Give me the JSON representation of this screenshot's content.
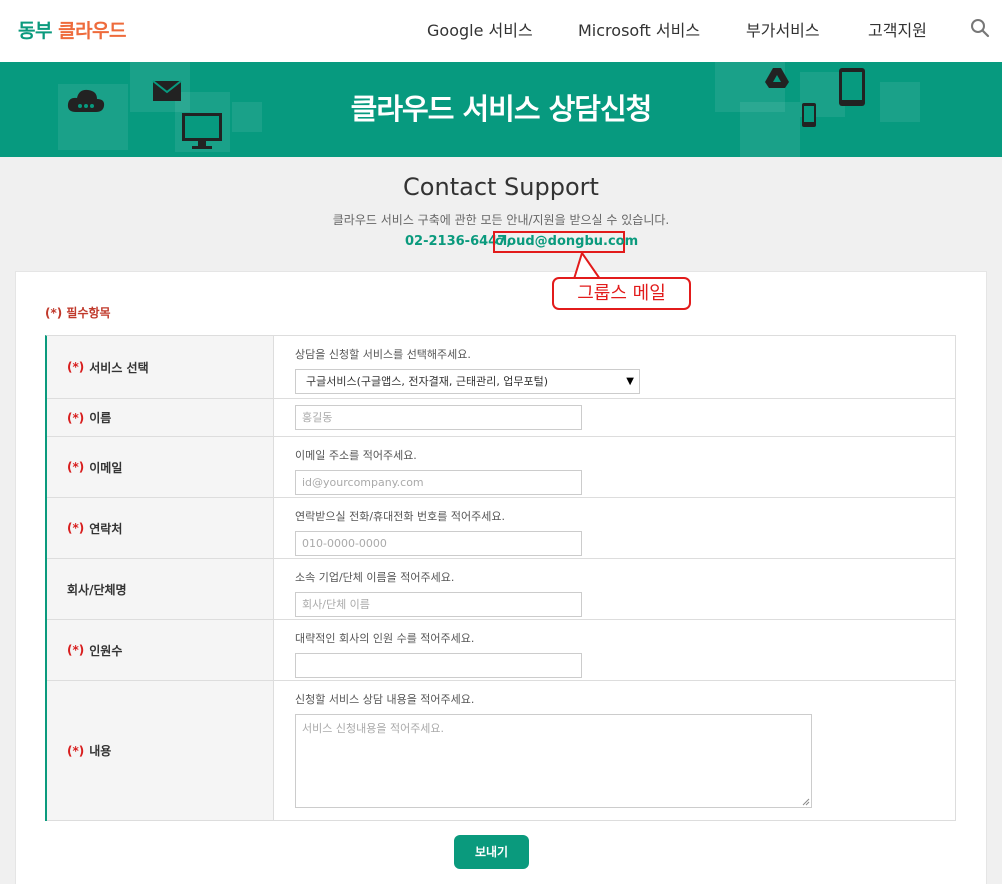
{
  "logo": {
    "part1": "동부",
    "part2": "클라우드"
  },
  "nav": {
    "items": [
      "Google 서비스",
      "Microsoft 서비스",
      "부가서비스",
      "고객지원"
    ],
    "search_icon": "search-icon"
  },
  "banner": {
    "title": "클라우드 서비스 상담신청"
  },
  "intro": {
    "title": "Contact Support",
    "description": "클라우드 서비스 구축에 관한 모든 안내/지원을 받으실 수 있습니다.",
    "phone": "02-2136-6447,",
    "email": "cloud@dongbu.com"
  },
  "annotation": {
    "label": "그룹스 메일"
  },
  "form": {
    "required_note": "(*) 필수항목",
    "required_mark": "(*)",
    "fields": {
      "service": {
        "label": "서비스 선택",
        "hint": "상담을 신청할 서비스를 선택해주세요.",
        "selected": "구글서비스(구글앱스, 전자결재, 근태관리, 업무포털)"
      },
      "name": {
        "label": "이름",
        "placeholder": "홍길동"
      },
      "email": {
        "label": "이메일",
        "hint": "이메일 주소를 적어주세요.",
        "placeholder": "id@yourcompany.com"
      },
      "phone": {
        "label": "연락처",
        "hint": "연락받으실 전화/휴대전화 번호를 적어주세요.",
        "placeholder": "010-0000-0000"
      },
      "company": {
        "label": "회사/단체명",
        "hint": "소속 기업/단체 이름을 적어주세요.",
        "placeholder": "회사/단체 이름"
      },
      "headcount": {
        "label": "인원수",
        "hint": "대략적인 회사의 인원 수를 적어주세요.",
        "placeholder": ""
      },
      "content": {
        "label": "내용",
        "hint": "신청할 서비스 상담 내용을 적어주세요.",
        "placeholder": "서비스 신청내용을 적어주세요."
      }
    },
    "submit_label": "보내기"
  },
  "colors": {
    "brand_green": "#0a9a7d",
    "brand_orange": "#ee6b3c",
    "required_red": "#d81e1e",
    "highlight_red": "#e21b1b"
  }
}
